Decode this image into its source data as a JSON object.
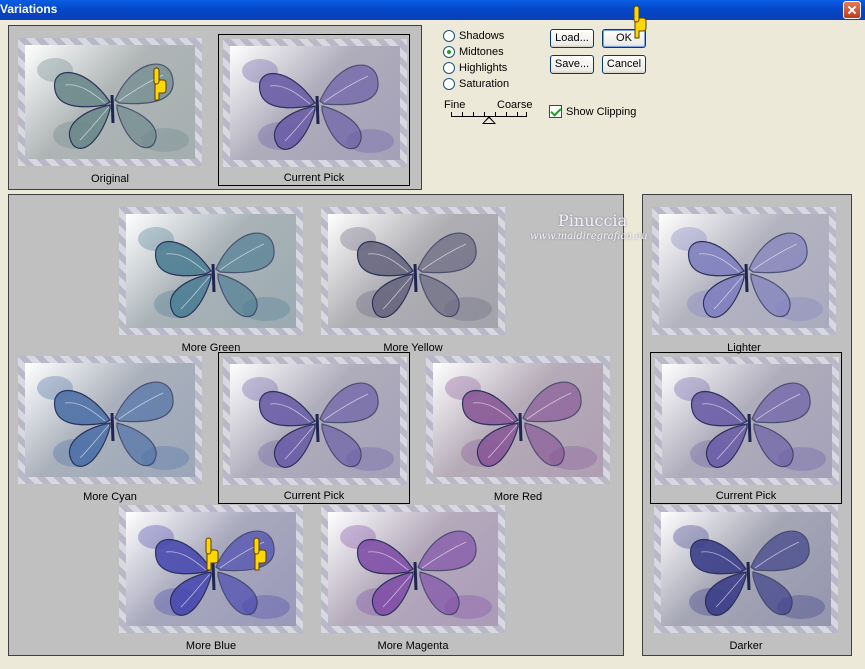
{
  "window": {
    "title": "Variations"
  },
  "range": {
    "options": [
      {
        "label": "Shadows",
        "selected": false
      },
      {
        "label": "Midtones",
        "selected": true
      },
      {
        "label": "Highlights",
        "selected": false
      },
      {
        "label": "Saturation",
        "selected": false
      }
    ]
  },
  "buttons": {
    "load": "Load...",
    "ok": "OK",
    "save": "Save...",
    "cancel": "Cancel"
  },
  "slider": {
    "fine": "Fine",
    "coarse": "Coarse",
    "value": 0.5
  },
  "show_clipping": {
    "label": "Show Clipping",
    "checked": true
  },
  "top": {
    "original": "Original",
    "current": "Current Pick"
  },
  "color_grid": {
    "more_green": "More Green",
    "more_yellow": "More Yellow",
    "more_cyan": "More Cyan",
    "current": "Current Pick",
    "more_red": "More Red",
    "more_blue": "More Blue",
    "more_magenta": "More Magenta"
  },
  "lightness": {
    "lighter": "Lighter",
    "current": "Current Pick",
    "darker": "Darker"
  },
  "watermark": {
    "name": "Pinuccia",
    "url": "www.maidiregrafica.eu"
  },
  "tints": {
    "original": "#6d8a8c",
    "current": "#6c5fa8",
    "more_green": "#4f7f95",
    "more_yellow": "#6a6880",
    "more_cyan": "#4f72a8",
    "more_red": "#8a5a98",
    "more_blue": "#4a4ab0",
    "more_magenta": "#8250a8",
    "lighter": "#8080bf",
    "darker": "#3d3f8a"
  }
}
